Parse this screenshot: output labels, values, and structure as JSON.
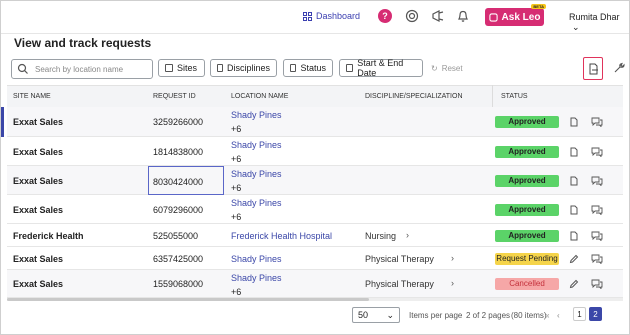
{
  "header": {
    "dashboard_label": "Dashboard",
    "help_label": "?",
    "ask_label": "Ask Leo",
    "beta_label": "BETA",
    "user_name": "Rumita Dhar"
  },
  "page": {
    "title": "View and track requests"
  },
  "filters": {
    "search_placeholder": "Search by location name",
    "sites": "Sites",
    "disciplines": "Disciplines",
    "status": "Status",
    "dates": "Start & End Date",
    "reset": "Reset"
  },
  "table": {
    "columns": [
      "SITE NAME",
      "REQUEST ID",
      "LOCATION NAME",
      "DISCIPLINE/SPECIALIZATION",
      "STATUS"
    ],
    "rows": [
      {
        "site": "Exxat Sales",
        "id": "3259266000",
        "location": "Shady Pines",
        "more": "+6",
        "discipline": "",
        "status": "Approved"
      },
      {
        "site": "Exxat Sales",
        "id": "1814838000",
        "location": "Shady Pines",
        "more": "+6",
        "discipline": "",
        "status": "Approved"
      },
      {
        "site": "Exxat Sales",
        "id": "8030424000",
        "location": "Shady Pines",
        "more": "+6",
        "discipline": "",
        "status": "Approved"
      },
      {
        "site": "Exxat Sales",
        "id": "6079296000",
        "location": "Shady Pines",
        "more": "+6",
        "discipline": "",
        "status": "Approved"
      },
      {
        "site": "Frederick Health",
        "id": "525055000",
        "location": "Frederick Health Hospital",
        "more": "",
        "discipline": "Nursing",
        "status": "Approved"
      },
      {
        "site": "Exxat Sales",
        "id": "6357425000",
        "location": "Shady Pines",
        "more": "",
        "discipline": "Physical Therapy",
        "status": "Request Pending"
      },
      {
        "site": "Exxat Sales",
        "id": "1559068000",
        "location": "Shady Pines",
        "more": "+6",
        "discipline": "Physical Therapy",
        "status": "Cancelled"
      }
    ]
  },
  "footer": {
    "page_size": "50",
    "items_per_page": "Items per page",
    "pages_info": "2 of 2 pages",
    "items_info": "(80 items)",
    "page1": "1",
    "page2": "2"
  },
  "colors": {
    "accent": "#3b47a8",
    "brand": "#d62c73",
    "approved": "#5bd368",
    "pending": "#f5d44a",
    "cancelled": "#f6a7a7"
  }
}
